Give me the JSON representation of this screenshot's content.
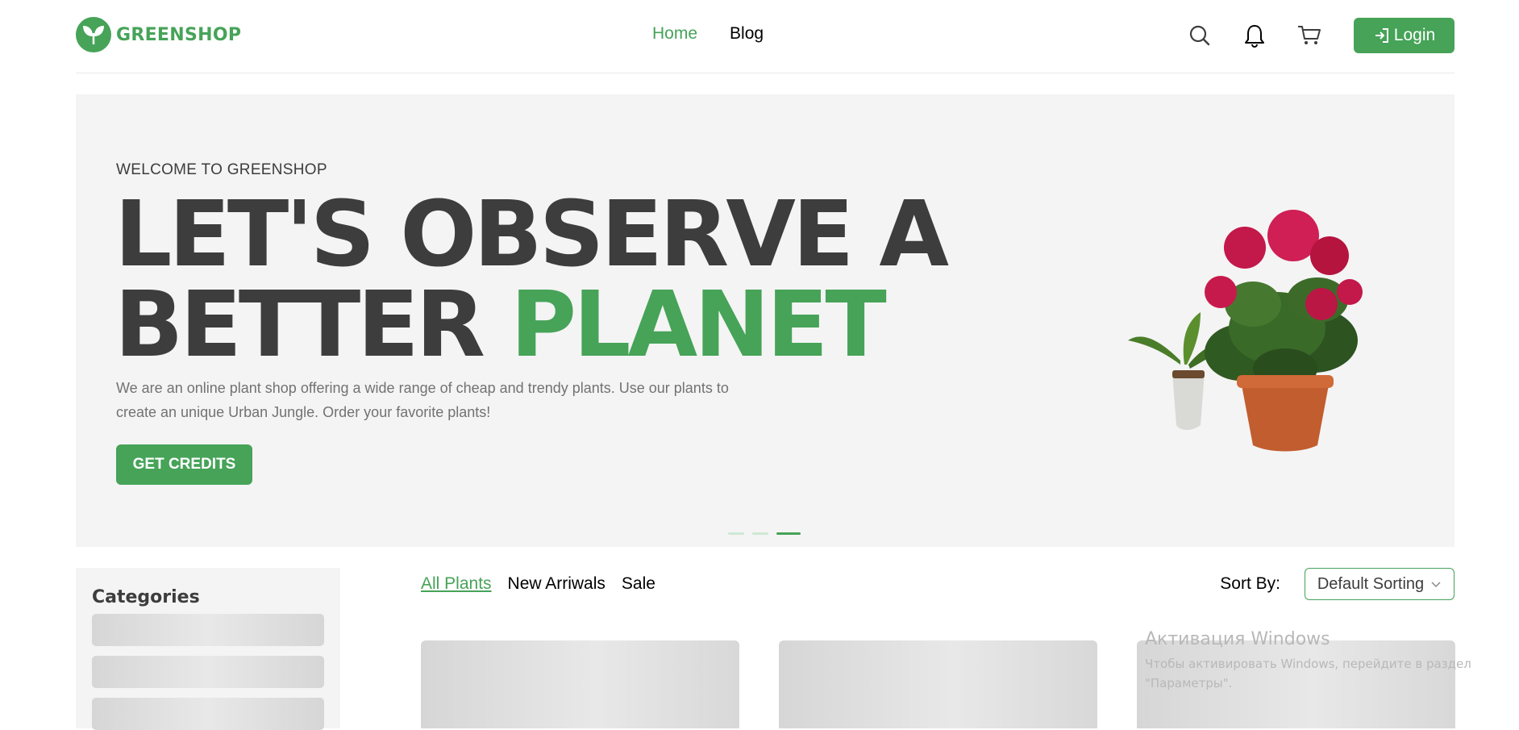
{
  "brand": {
    "name": "GREENSHOP",
    "accent_color": "#46a358",
    "logo_icon": "leaf-logo-icon"
  },
  "nav": {
    "items": [
      {
        "label": "Home",
        "active": true
      },
      {
        "label": "Blog",
        "active": false
      }
    ]
  },
  "header_actions": {
    "icons": [
      "search-icon",
      "bell-icon",
      "cart-icon"
    ],
    "login_label": "Login",
    "login_icon": "login-icon"
  },
  "hero": {
    "subtitle": "WELCOME TO GREENSHOP",
    "title_line1": "LET'S OBSERVE A",
    "title_line2_plain": "BETTER ",
    "title_line2_accent": "PLANET",
    "description": "We are an online plant shop offering a wide range of cheap and trendy plants. Use our plants to create an unique Urban Jungle. Order your favorite plants!",
    "cta_label": "GET CREDITS",
    "slides_total": 3,
    "active_slide": 3
  },
  "sidebar": {
    "title": "Categories"
  },
  "filters": {
    "tabs": [
      {
        "label": "All Plants",
        "active": true
      },
      {
        "label": "New Arriwals",
        "active": false
      },
      {
        "label": "Sale",
        "active": false
      }
    ],
    "sort_label": "Sort By:",
    "sort_value": "Default Sorting"
  },
  "watermark": {
    "title": "Активация Windows",
    "text": "Чтобы активировать Windows, перейдите в раздел \"Параметры\"."
  }
}
